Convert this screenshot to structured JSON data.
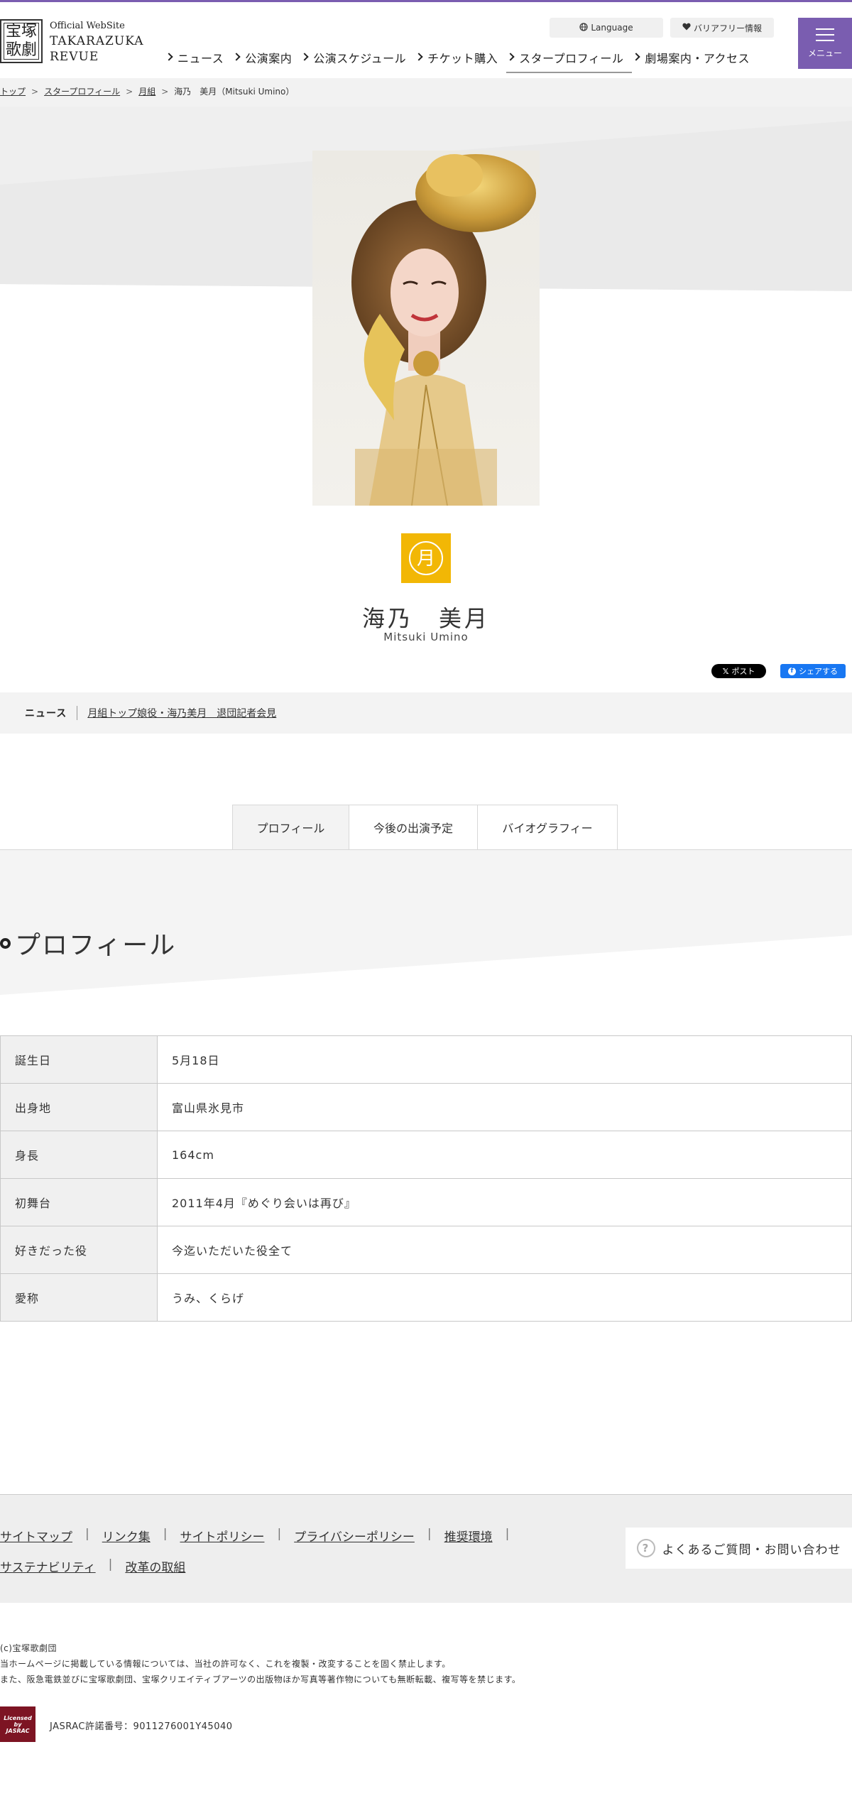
{
  "header": {
    "logo_kanji_1": "宝塚",
    "logo_kanji_2": "歌劇",
    "logo_official": "Official WebSite",
    "logo_en": "TAKARAZUKA\nREVUE",
    "language_label": "Language",
    "barrier_free_label": "バリアフリー情報",
    "menu_label": "メニュー",
    "nav": [
      {
        "label": "ニュース"
      },
      {
        "label": "公演案内"
      },
      {
        "label": "公演スケジュール"
      },
      {
        "label": "チケット購入"
      },
      {
        "label": "スタープロフィール"
      },
      {
        "label": "劇場案内・アクセス"
      }
    ],
    "accent_color": "#7a5db0"
  },
  "breadcrumb": {
    "items": [
      "トップ",
      "スタープロフィール",
      "月組",
      "海乃　美月（Mitsuki Umino）"
    ],
    "separator": ">"
  },
  "star": {
    "troupe_glyph": "月",
    "troupe_color": "#f2b705",
    "name": "海乃　美月",
    "roman": "Mitsuki Umino"
  },
  "share": {
    "x_label": "ポスト",
    "fb_label": "シェアする"
  },
  "news": {
    "heading": "ニュース",
    "link": "月組トップ娘役・海乃美月　退団記者会見"
  },
  "tabs": [
    {
      "label": "プロフィール",
      "active": true
    },
    {
      "label": "今後の出演予定",
      "active": false
    },
    {
      "label": "バイオグラフィー",
      "active": false
    }
  ],
  "profile": {
    "title": "プロフィール",
    "rows": [
      {
        "label": "誕生日",
        "value": "5月18日"
      },
      {
        "label": "出身地",
        "value": "富山県氷見市"
      },
      {
        "label": "身長",
        "value": "164cm"
      },
      {
        "label": "初舞台",
        "value": "2011年4月『めぐり会いは再び』"
      },
      {
        "label": "好きだった役",
        "value": "今迄いただいた役全て"
      },
      {
        "label": "愛称",
        "value": "うみ、くらげ"
      }
    ]
  },
  "footer": {
    "links": [
      "サイトマップ",
      "リンク集",
      "サイトポリシー",
      "プライバシーポリシー",
      "推奨環境",
      "サステナビリティ",
      "改革の取組"
    ],
    "faq_label": "よくあるご質問・お問い合わせ",
    "faq_icon": "?",
    "copyright_lines": [
      "(c)宝塚歌劇団",
      "当ホームページに掲載している情報については、当社の許可なく、これを複製・改変することを固く禁止します。",
      "また、阪急電鉄並びに宝塚歌劇団、宝塚クリエイティブアーツの出版物ほか写真等著作物についても無断転載、複写等を禁じます。"
    ],
    "jasrac_logo_text": "Licensed by JASRAC",
    "jasrac_number": "JASRAC許諾番号：9011276001Y45040"
  }
}
